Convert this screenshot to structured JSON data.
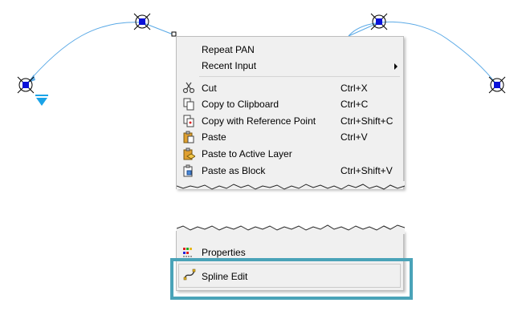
{
  "context_menu": {
    "top_items": [
      {
        "label": "Repeat PAN",
        "shortcut": "",
        "submenu": false
      },
      {
        "label": "Recent Input",
        "shortcut": "",
        "submenu": true
      }
    ],
    "edit_items": [
      {
        "label": "Cut",
        "shortcut": "Ctrl+X",
        "icon": "scissors-icon"
      },
      {
        "label": "Copy to Clipboard",
        "shortcut": "Ctrl+C",
        "icon": "copy-icon"
      },
      {
        "label": "Copy with Reference Point",
        "shortcut": "Ctrl+Shift+C",
        "icon": "copy-reference-icon"
      },
      {
        "label": "Paste",
        "shortcut": "Ctrl+V",
        "icon": "paste-icon"
      },
      {
        "label": "Paste to Active Layer",
        "shortcut": "",
        "icon": "paste-layer-icon"
      },
      {
        "label": "Paste as Block",
        "shortcut": "Ctrl+Shift+V",
        "icon": "paste-block-icon"
      }
    ],
    "bottom_items": [
      {
        "label": "Properties",
        "icon": "properties-icon"
      },
      {
        "label": "Spline Edit",
        "icon": "spline-edit-icon"
      }
    ]
  },
  "colors": {
    "spline": "#5aa9e6",
    "grip_fill": "#0a12d8",
    "highlight": "#4aa3b8",
    "ucs_marker": "#1aa3e8"
  }
}
